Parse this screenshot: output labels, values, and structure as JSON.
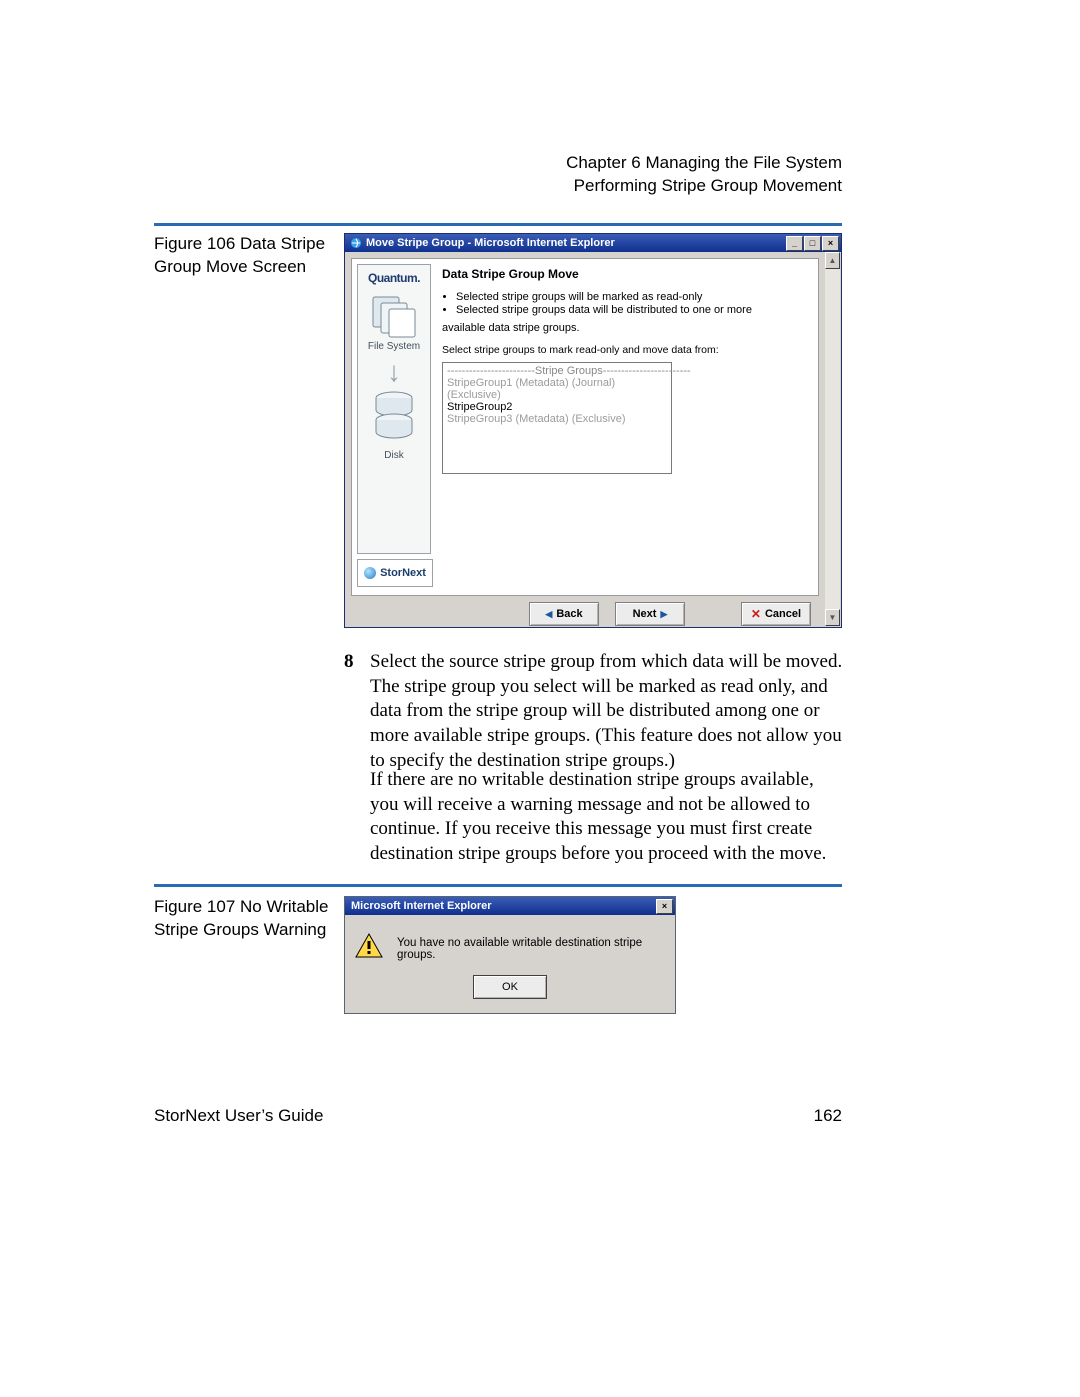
{
  "header": {
    "chapter": "Chapter 6  Managing the File System",
    "section": "Performing Stripe Group Movement"
  },
  "figure106": {
    "caption": "Figure 106  Data Stripe Group Move Screen",
    "window_title": "Move Stripe Group - Microsoft Internet Explorer",
    "sidebar": {
      "brand": "Quantum.",
      "fs_label": "File System",
      "disk_label": "Disk",
      "product": "StorNext"
    },
    "panel": {
      "title": "Data Stripe Group Move",
      "bullet1": "Selected stripe groups will be marked as read-only",
      "bullet2": "Selected stripe groups data will be distributed to one or more",
      "bullet2_cont": "available data stripe groups.",
      "instruction": "Select stripe groups to mark read-only and move data from:",
      "list_header": "------------------------Stripe Groups------------------------",
      "item1": "StripeGroup1 (Metadata) (Journal) (Exclusive)",
      "item2": "StripeGroup2",
      "item3": "StripeGroup3 (Metadata) (Exclusive)"
    },
    "buttons": {
      "back": "Back",
      "next": "Next",
      "cancel": "Cancel"
    }
  },
  "step8": {
    "num": "8",
    "para1": "Select the source stripe group from which data will be moved. The stripe group you select will be marked as read only, and data from the stripe group will be distributed among one or more available stripe groups. (This feature does not allow you to specify the destination stripe groups.)",
    "para2": "If there are no writable destination stripe groups available, you will receive a warning message and not be allowed to continue. If you receive this message you must first create destination stripe groups before you proceed with the move."
  },
  "figure107": {
    "caption": "Figure 107   No Writable Stripe Groups Warning",
    "title": "Microsoft Internet Explorer",
    "message": "You have no available writable destination stripe groups.",
    "ok": "OK"
  },
  "footer": {
    "left": "StorNext User’s Guide",
    "right": "162"
  }
}
